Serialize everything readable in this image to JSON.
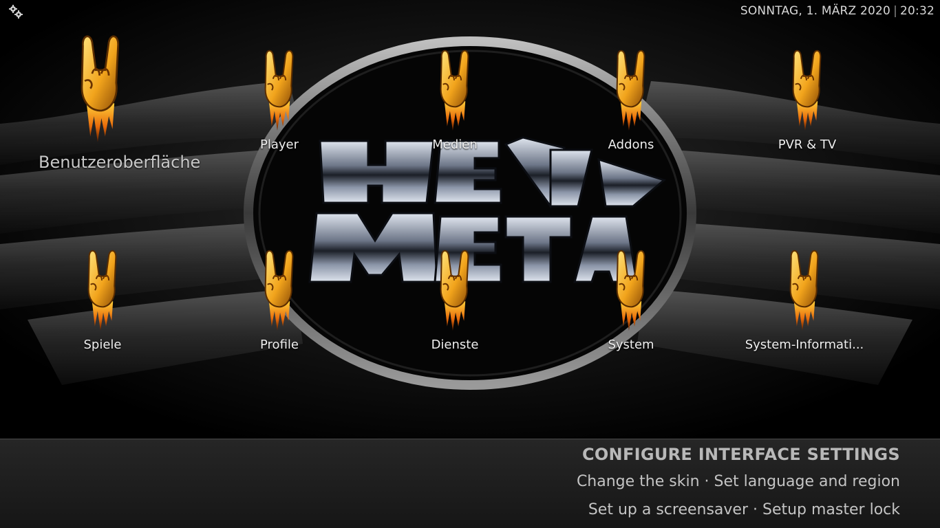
{
  "header": {
    "datetime": "SONNTAG, 1. MÄRZ 2020",
    "separator": "|",
    "time": "20:32",
    "settings_icon": "gears-icon"
  },
  "background": {
    "logo_icon": "heavy-metal-logo-icon"
  },
  "menu": {
    "icon": "rock-hand-icon",
    "items": [
      {
        "label": "Benutzeroberfläche"
      },
      {
        "label": "Player"
      },
      {
        "label": "Medien"
      },
      {
        "label": "Addons"
      },
      {
        "label": "PVR & TV"
      },
      {
        "label": "Spiele"
      },
      {
        "label": "Profile"
      },
      {
        "label": "Dienste"
      },
      {
        "label": "System"
      },
      {
        "label": "System-Informati..."
      }
    ]
  },
  "footer": {
    "heading": "CONFIGURE INTERFACE SETTINGS",
    "line1": "Change the skin · Set language and region",
    "line2": "Set up a screensaver · Setup master lock"
  }
}
